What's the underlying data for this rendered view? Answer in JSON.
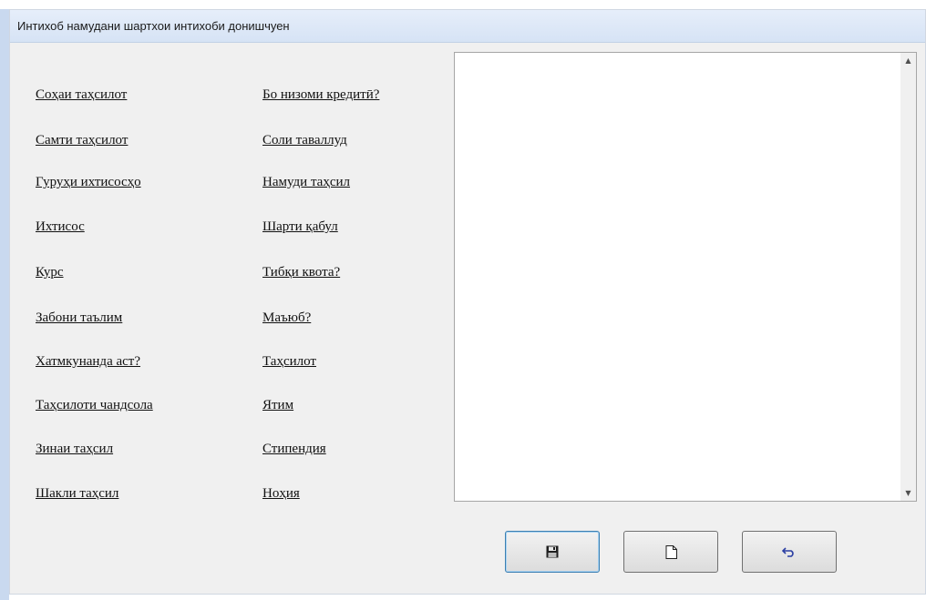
{
  "window": {
    "title": "Интихоб намудани шартхои интихоби донишчуен"
  },
  "links": {
    "left": [
      "Соҳаи таҳсилот",
      "Самти таҳсилот",
      "Гуруҳи ихтисосҳо",
      "Ихтисос",
      "Курс",
      "Забони таълим",
      "Хатмкунанда аст?",
      "Таҳсилоти чандсола",
      "Зинаи таҳсил",
      "Шакли таҳсил"
    ],
    "right": [
      "Бо низоми кредитӣ?",
      "Соли таваллуд",
      "Намуди таҳсил",
      "Шарти қабул",
      "Тибқи квота?",
      "Маъюб?",
      "Таҳсилот",
      "Ятим",
      "Стипендия",
      "Ноҳия"
    ]
  },
  "listbox": {
    "items": [],
    "scroll_up_icon": "scroll-up-arrow",
    "scroll_down_icon": "scroll-down-arrow"
  },
  "buttons": [
    {
      "name": "save-button",
      "icon": "floppy-disk-icon"
    },
    {
      "name": "new-button",
      "icon": "blank-document-icon"
    },
    {
      "name": "undo-button",
      "icon": "undo-arrow-icon"
    }
  ],
  "colors": {
    "dialog_background": "#f0f0f0",
    "title_bar": "#dae6f6",
    "link_text": "#111111",
    "focused_button_border": "#3c7fb1"
  }
}
